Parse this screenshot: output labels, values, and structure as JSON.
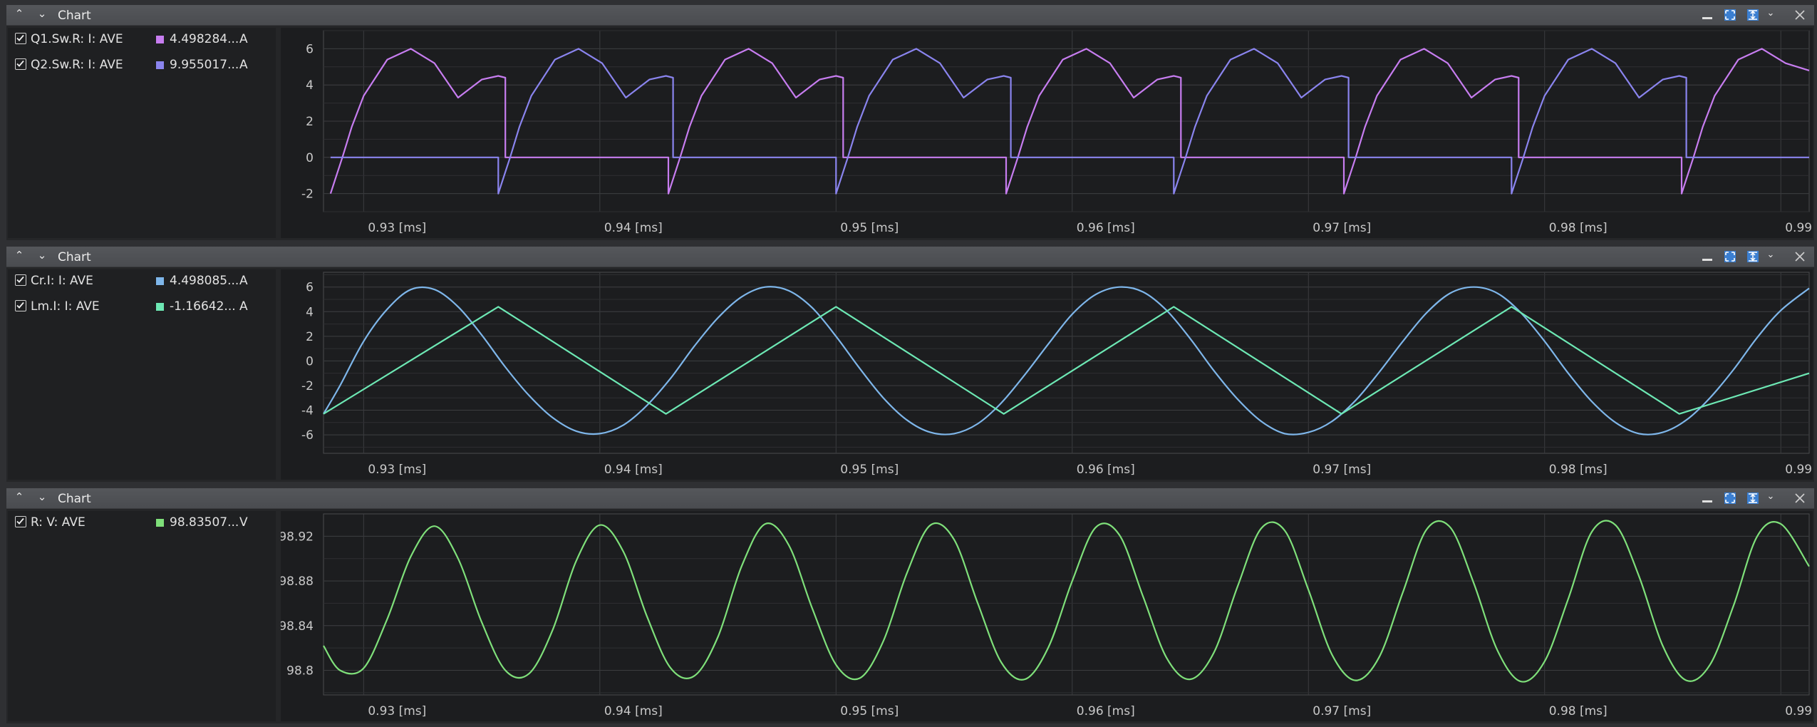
{
  "panels": [
    {
      "title": "Chart",
      "legend": [
        {
          "name": "Q1.Sw.R: I: AVE",
          "value": "4.498284...",
          "unit": "A",
          "color": "#c77df0"
        },
        {
          "name": "Q2.Sw.R: I: AVE",
          "value": "9.955017...",
          "unit": "A",
          "color": "#8a84ee"
        }
      ]
    },
    {
      "title": "Chart",
      "legend": [
        {
          "name": "Cr.I: I: AVE",
          "value": "4.498085...",
          "unit": "A",
          "color": "#7eb6ea"
        },
        {
          "name": "Lm.I: I: AVE",
          "value": "-1.16642...",
          "unit": "A",
          "color": "#6de8b4"
        }
      ]
    },
    {
      "title": "Chart",
      "legend": [
        {
          "name": "R: V: AVE",
          "value": "98.83507...",
          "unit": "V",
          "color": "#7fe07a"
        }
      ]
    }
  ],
  "chart_data": [
    {
      "type": "line",
      "x_ticks": [
        "0.93 [ms]",
        "0.94 [ms]",
        "0.95 [ms]",
        "0.96 [ms]",
        "0.97 [ms]",
        "0.98 [ms]",
        "0.99 [ms]"
      ],
      "y_ticks": [
        "6",
        "4",
        "2",
        "0",
        "-2"
      ],
      "xlim": [
        0.9283,
        0.9912
      ],
      "ylim": [
        -3.0,
        7.0
      ],
      "grid": true,
      "period_ms": 0.01431,
      "series": [
        {
          "name": "Q1.Sw.R: I: AVE",
          "color": "#c77df0",
          "x": [
            0.9286,
            0.9291,
            0.9295,
            0.93,
            0.931,
            0.932,
            0.933,
            0.934,
            0.935,
            0.9357,
            0.936,
            0.936,
            0.938,
            0.94,
            0.942,
            0.9429,
            0.9429,
            0.9434,
            0.9438,
            0.9443,
            0.9453,
            0.9463,
            0.9473,
            0.9483,
            0.9493,
            0.95,
            0.9503,
            0.9503,
            0.9523,
            0.9543,
            0.9563,
            0.9572,
            0.9572,
            0.9577,
            0.9581,
            0.9586,
            0.9596,
            0.9606,
            0.9616,
            0.9626,
            0.9636,
            0.9643,
            0.9646,
            0.9646,
            0.9666,
            0.9686,
            0.9706,
            0.9715,
            0.9715,
            0.972,
            0.9724,
            0.9729,
            0.9739,
            0.9749,
            0.9759,
            0.9769,
            0.9779,
            0.9786,
            0.9789,
            0.9789,
            0.9809,
            0.9829,
            0.9849,
            0.9858,
            0.9858,
            0.9863,
            0.9867,
            0.9872,
            0.9882,
            0.9892,
            0.9902,
            0.9912
          ],
          "y": [
            -2.0,
            0.0,
            1.7,
            3.4,
            5.4,
            6.0,
            5.2,
            3.3,
            4.3,
            4.5,
            4.4,
            0,
            0,
            0,
            0,
            0,
            -2.0,
            0.0,
            1.7,
            3.4,
            5.4,
            6.0,
            5.2,
            3.3,
            4.3,
            4.5,
            4.4,
            0,
            0,
            0,
            0,
            0,
            -2.0,
            0.0,
            1.7,
            3.4,
            5.4,
            6.0,
            5.2,
            3.3,
            4.3,
            4.5,
            4.4,
            0,
            0,
            0,
            0,
            0,
            -2.0,
            0.0,
            1.7,
            3.4,
            5.4,
            6.0,
            5.2,
            3.3,
            4.3,
            4.5,
            4.4,
            0,
            0,
            0,
            0,
            0,
            -2.0,
            0.0,
            1.7,
            3.4,
            5.4,
            6.0,
            5.2,
            4.8
          ]
        },
        {
          "name": "Q2.Sw.R: I: AVE",
          "color": "#8a84ee",
          "x": [
            0.9286,
            0.9306,
            0.9326,
            0.9346,
            0.9357,
            0.9357,
            0.9362,
            0.9366,
            0.9371,
            0.9381,
            0.9391,
            0.9401,
            0.9411,
            0.9421,
            0.9428,
            0.9431,
            0.9431,
            0.9451,
            0.9471,
            0.9491,
            0.95,
            0.95,
            0.9505,
            0.9509,
            0.9514,
            0.9524,
            0.9534,
            0.9544,
            0.9554,
            0.9564,
            0.9571,
            0.9574,
            0.9574,
            0.9594,
            0.9614,
            0.9634,
            0.9643,
            0.9643,
            0.9648,
            0.9652,
            0.9657,
            0.9667,
            0.9677,
            0.9687,
            0.9697,
            0.9707,
            0.9714,
            0.9717,
            0.9717,
            0.9737,
            0.9757,
            0.9777,
            0.9786,
            0.9786,
            0.9791,
            0.9795,
            0.98,
            0.981,
            0.982,
            0.983,
            0.984,
            0.985,
            0.9857,
            0.986,
            0.986,
            0.988,
            0.99,
            0.9912
          ],
          "y": [
            0,
            0,
            0,
            0,
            0,
            -2.0,
            0.0,
            1.7,
            3.4,
            5.4,
            6.0,
            5.2,
            3.3,
            4.3,
            4.5,
            4.4,
            0,
            0,
            0,
            0,
            0,
            -2.0,
            0.0,
            1.7,
            3.4,
            5.4,
            6.0,
            5.2,
            3.3,
            4.3,
            4.5,
            4.4,
            0,
            0,
            0,
            0,
            0,
            -2.0,
            0.0,
            1.7,
            3.4,
            5.4,
            6.0,
            5.2,
            3.3,
            4.3,
            4.5,
            4.4,
            0,
            0,
            0,
            0,
            0,
            -2.0,
            0.0,
            1.7,
            3.4,
            5.4,
            6.0,
            5.2,
            3.3,
            4.3,
            4.5,
            4.4,
            0,
            0,
            0,
            0
          ]
        }
      ]
    },
    {
      "type": "line",
      "x_ticks": [
        "0.93 [ms]",
        "0.94 [ms]",
        "0.95 [ms]",
        "0.96 [ms]",
        "0.97 [ms]",
        "0.98 [ms]",
        "0.99 [ms]"
      ],
      "y_ticks": [
        "6",
        "4",
        "2",
        "0",
        "-2",
        "-4",
        "-6"
      ],
      "xlim": [
        0.9283,
        0.9912
      ],
      "ylim": [
        -7.5,
        7.2
      ],
      "grid": true,
      "series": [
        {
          "name": "Cr.I: I: AVE",
          "color": "#7eb6ea",
          "x": [
            0.9283,
            0.929,
            0.93,
            0.931,
            0.932,
            0.933,
            0.934,
            0.935,
            0.936,
            0.937,
            0.938,
            0.939,
            0.94,
            0.941,
            0.942,
            0.943,
            0.944,
            0.945,
            0.946,
            0.947,
            0.948,
            0.949,
            0.95,
            0.951,
            0.952,
            0.953,
            0.954,
            0.955,
            0.956,
            0.957,
            0.958,
            0.959,
            0.96,
            0.961,
            0.962,
            0.963,
            0.964,
            0.965,
            0.966,
            0.967,
            0.968,
            0.969,
            0.97,
            0.971,
            0.972,
            0.973,
            0.974,
            0.975,
            0.976,
            0.977,
            0.978,
            0.979,
            0.98,
            0.981,
            0.982,
            0.983,
            0.984,
            0.985,
            0.986,
            0.987,
            0.988,
            0.989,
            0.99,
            0.9912
          ],
          "y": [
            -4.3,
            -2.0,
            1.6,
            4.2,
            5.8,
            5.8,
            4.4,
            2.1,
            -0.5,
            -2.8,
            -4.6,
            -5.7,
            -5.9,
            -5.2,
            -3.6,
            -1.4,
            1.2,
            3.5,
            5.2,
            6.0,
            5.7,
            4.3,
            2.0,
            -0.6,
            -3.0,
            -4.8,
            -5.8,
            -5.9,
            -5.1,
            -3.4,
            -1.1,
            1.4,
            3.8,
            5.4,
            6.0,
            5.6,
            4.1,
            1.8,
            -0.8,
            -3.1,
            -4.9,
            -5.9,
            -5.8,
            -4.9,
            -3.2,
            -0.9,
            1.6,
            3.9,
            5.5,
            6.0,
            5.5,
            3.9,
            1.6,
            -1.0,
            -3.3,
            -5.0,
            -5.9,
            -5.8,
            -4.8,
            -3.0,
            -0.7,
            1.9,
            4.1,
            5.9
          ]
        },
        {
          "name": "Lm.I: I: AVE",
          "color": "#6de8b4",
          "x": [
            0.9283,
            0.9357,
            0.9428,
            0.95,
            0.9571,
            0.9643,
            0.9714,
            0.9786,
            0.9857,
            0.9912
          ],
          "y": [
            -4.3,
            4.4,
            -4.3,
            4.4,
            -4.3,
            4.4,
            -4.3,
            4.4,
            -4.3,
            -1.0
          ]
        }
      ]
    },
    {
      "type": "line",
      "x_ticks": [
        "0.93 [ms]",
        "0.94 [ms]",
        "0.95 [ms]",
        "0.96 [ms]",
        "0.97 [ms]",
        "0.98 [ms]",
        "0.99 [ms]"
      ],
      "y_ticks": [
        "98.92",
        "98.88",
        "98.84",
        "98.8"
      ],
      "xlim": [
        0.9283,
        0.9912
      ],
      "ylim": [
        98.778,
        98.94
      ],
      "grid": true,
      "series": [
        {
          "name": "R: V: AVE",
          "color": "#7fe07a",
          "x": [
            0.9283,
            0.929,
            0.93,
            0.931,
            0.932,
            0.933,
            0.934,
            0.935,
            0.936,
            0.937,
            0.938,
            0.939,
            0.94,
            0.941,
            0.942,
            0.943,
            0.944,
            0.945,
            0.946,
            0.947,
            0.948,
            0.949,
            0.95,
            0.951,
            0.952,
            0.953,
            0.954,
            0.955,
            0.956,
            0.957,
            0.958,
            0.959,
            0.96,
            0.961,
            0.962,
            0.963,
            0.964,
            0.965,
            0.966,
            0.967,
            0.968,
            0.969,
            0.97,
            0.971,
            0.972,
            0.973,
            0.974,
            0.975,
            0.976,
            0.977,
            0.978,
            0.979,
            0.98,
            0.981,
            0.982,
            0.983,
            0.984,
            0.985,
            0.986,
            0.987,
            0.988,
            0.989,
            0.99,
            0.9912
          ],
          "y": [
            98.822,
            98.8,
            98.802,
            98.846,
            98.902,
            98.929,
            98.9,
            98.843,
            98.8,
            98.797,
            98.836,
            98.898,
            98.93,
            98.906,
            98.848,
            98.802,
            98.795,
            98.83,
            98.893,
            98.931,
            98.912,
            98.855,
            98.805,
            98.793,
            98.826,
            98.887,
            98.93,
            98.917,
            98.86,
            98.807,
            98.792,
            98.821,
            98.88,
            98.928,
            98.921,
            98.866,
            98.811,
            98.792,
            98.816,
            98.875,
            98.927,
            98.925,
            98.872,
            98.814,
            98.791,
            98.812,
            98.87,
            98.926,
            98.928,
            98.878,
            98.818,
            98.79,
            98.808,
            98.864,
            98.924,
            98.93,
            98.884,
            98.822,
            98.791,
            98.805,
            98.858,
            98.92,
            98.931,
            98.893
          ]
        }
      ]
    }
  ]
}
